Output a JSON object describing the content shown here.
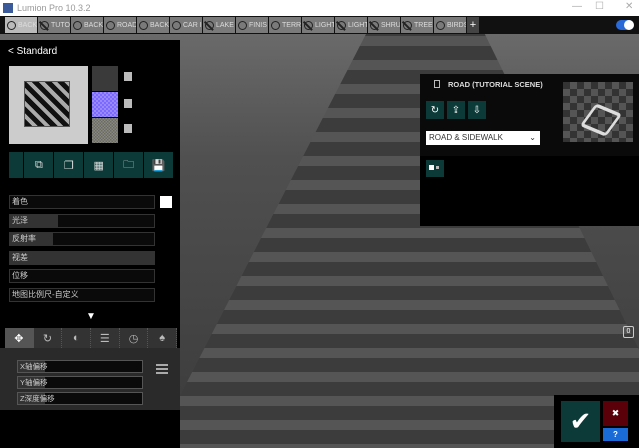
{
  "window": {
    "title": "Lumion Pro 10.3.2",
    "minimize": "—",
    "maximize": "☐",
    "close": "✕"
  },
  "tabs": [
    {
      "label": "BACK",
      "visible": true,
      "active": true
    },
    {
      "label": "TUTO",
      "visible": false
    },
    {
      "label": "BACK",
      "visible": true
    },
    {
      "label": "ROAD",
      "visible": true
    },
    {
      "label": "BACK",
      "visible": true
    },
    {
      "label": "CAR I",
      "visible": true
    },
    {
      "label": "LAKE",
      "visible": false
    },
    {
      "label": "FINIS",
      "visible": true
    },
    {
      "label": "TERR",
      "visible": true
    },
    {
      "label": "LIGHT",
      "visible": false
    },
    {
      "label": "LIGHT",
      "visible": false
    },
    {
      "label": "SHRU",
      "visible": false
    },
    {
      "label": "TREE",
      "visible": false
    },
    {
      "label": "BIRDS",
      "visible": true
    }
  ],
  "add_tab": "+",
  "material": {
    "title": "Standard",
    "back": "<",
    "swatch_colors": [
      "#3a3a3a",
      "#7a6aff",
      "#8a8a7a"
    ],
    "properties": [
      {
        "label": "着色",
        "value": 0
      },
      {
        "label": "光泽",
        "value": 0.33
      },
      {
        "label": "反射率",
        "value": 0.3
      },
      {
        "label": "视差",
        "value": 1.0
      },
      {
        "label": "位移",
        "value": 0
      },
      {
        "label": "地图比例尺-自定义",
        "value": 0
      }
    ],
    "expand": "▼"
  },
  "tools": [
    "✥",
    "↻",
    "◐",
    "☰",
    "◷",
    "♠"
  ],
  "offsets": [
    {
      "label": "X轴偏移"
    },
    {
      "label": "Y轴偏移"
    },
    {
      "label": "Z深度偏移"
    }
  ],
  "object_panel": {
    "title": "ROAD (TUTORIAL SCENE)",
    "buttons": [
      "↻",
      "⇪",
      "⇩"
    ],
    "category": "ROAD & SIDEWALK",
    "chevron": "⌄"
  },
  "camera_label": "0",
  "confirm": {
    "ok": "✔",
    "cancel": "✖",
    "help": "?"
  },
  "colors": {
    "accent": "#0b3a38",
    "cancel": "#5a0008",
    "help": "#1a6ad8"
  }
}
